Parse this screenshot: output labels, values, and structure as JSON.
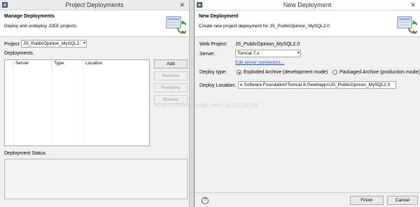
{
  "left_window": {
    "title": "Project Deployments",
    "close_glyph": "✕",
    "banner": {
      "title": "Manage Deployments",
      "description": "Deploy and undeploy J2EE projects.",
      "icon": "deployment-wizard-icon"
    },
    "project_label": "Project",
    "project_value": "JS_PublicOpinion_MySQL2.",
    "deployments_label": "Deployments",
    "table_headers": [
      "Server",
      "Type",
      "Location"
    ],
    "buttons": {
      "add": "Add",
      "remove": "Remove",
      "redeploy": "Redeploy",
      "browse": "Browse"
    },
    "status_label": "Deployment Status"
  },
  "right_window": {
    "title": "New Deployment",
    "close_glyph": "✕",
    "banner": {
      "title": "New Deployment",
      "description": "Create new project deployment for JS_PublicOpinion_MySQL2.0",
      "icon": "deployment-wizard-icon"
    },
    "web_project_label": "Web Project:",
    "web_project_value": "JS_PublicOpinion_MySQL2.0",
    "server_label": "Server:",
    "server_value": "Tomcat  7.x",
    "edit_connectors_link": "Edit server connectors...",
    "deploy_type_label": "Deploy type:",
    "deploy_type_options": [
      "Exploded Archive (development mode)",
      "Packaged Archive (production mode)"
    ],
    "deploy_type_selected": 0,
    "deploy_location_label": "Deploy Location:",
    "deploy_location_value": "e Software Foundation\\Tomcat 8.0\\webapps\\JS_PublicOpinion_MySQL2.0",
    "help_glyph": "?",
    "buttons": {
      "finish": "Finish",
      "cancel": "Cancel"
    }
  },
  "watermark": "http://blog.csdn.net/u012110719"
}
